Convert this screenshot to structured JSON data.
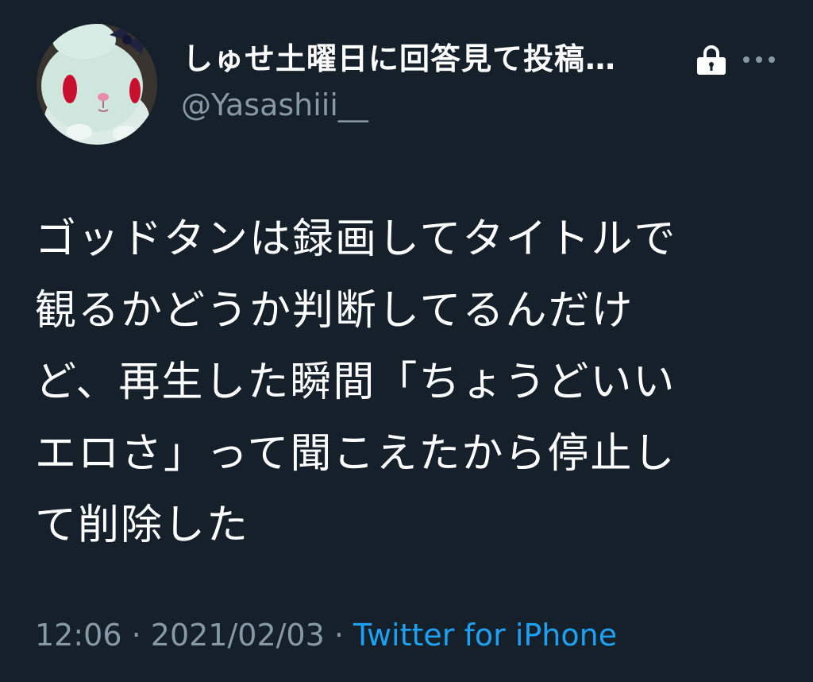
{
  "user": {
    "display_name": "しゅせ土曜日に回答見て投稿…",
    "handle": "@Yasashiii__",
    "avatar_icon": "plush-bunny-avatar",
    "protected_icon": "lock-icon",
    "more_icon": "more-options-icon"
  },
  "tweet": {
    "text": "ゴッドタンは録画してタイトルで\n観るかどうか判断してるんだけ\nど、再生した瞬間「ちょうどいい\nエロさ」って聞こえたから停止し\nて削除した"
  },
  "meta": {
    "time": "12:06",
    "separator1": " · ",
    "date": "2021/02/03",
    "separator2": " · ",
    "source": "Twitter for iPhone"
  },
  "colors": {
    "background": "#15202b",
    "text": "#ffffff",
    "secondary": "#8899a6",
    "accent": "#1da1f2"
  }
}
